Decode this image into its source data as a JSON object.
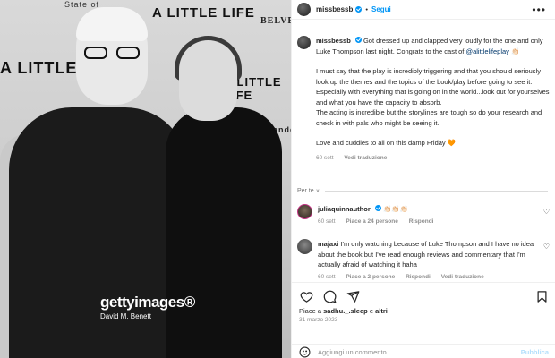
{
  "photo": {
    "banners": [
      "A LITTLE LIFE",
      "A LITTLE",
      "A LITTLE LIFE",
      "State of",
      "BELVEDERE",
      "Flanders"
    ],
    "watermark_logo": "gettyimages®",
    "watermark_credit": "David M. Benett"
  },
  "header": {
    "username": "missbessb",
    "separator": "•",
    "follow_label": "Segui",
    "more_label": "•••"
  },
  "caption": {
    "username": "missbessb",
    "line1": "Got dressed up and clapped very loudly for the one and only Luke Thompson last night. Congrats to the cast of",
    "mention": "@alittlelifeplay",
    "line1_emoji": "👏🏻",
    "para2": "I must say that the play is incredibly triggering and that you should seriously look up the themes and the topics of the book/play before going to see it. Especially with everything that is going on in the world...look out for yourselves and what you have the capacity to absorb.",
    "para3": "The acting is incredible but the storylines are tough so do your research and check in with pals who might be seeing it.",
    "para4": "Love and cuddles to all on this damp Friday",
    "para4_emoji": "🧡",
    "time": "60 sett",
    "translate": "Vedi traduzione"
  },
  "separator": {
    "label": "Per te",
    "chevron": "∨"
  },
  "comments": [
    {
      "username": "juliaquinnauthor",
      "text": "👏🏻👏🏻👏🏻",
      "time": "60 sett",
      "likes": "Piace a 24 persone",
      "reply": "Rispondi",
      "heart": "♡"
    },
    {
      "username": "majaxi",
      "text": "I'm only watching because of Luke Thompson and I have no idea about the book but I've read enough reviews and commentary that I'm actually afraid of watching it haha",
      "time": "60 sett",
      "likes": "Piace a 2 persone",
      "reply": "Rispondi",
      "translate": "Vedi traduzione",
      "heart": "♡"
    }
  ],
  "actions": {
    "likes_prefix": "Piace a",
    "likes_user": "sadhu._.sleep",
    "likes_connector": "e",
    "likes_others": "altri",
    "date": "31 marzo 2023"
  },
  "add_comment": {
    "placeholder": "Aggiungi un commento...",
    "publish_label": "Pubblica"
  },
  "icons": [
    "heart-icon",
    "comment-icon",
    "share-icon",
    "bookmark-icon",
    "emoji-icon",
    "verified-badge-icon"
  ]
}
